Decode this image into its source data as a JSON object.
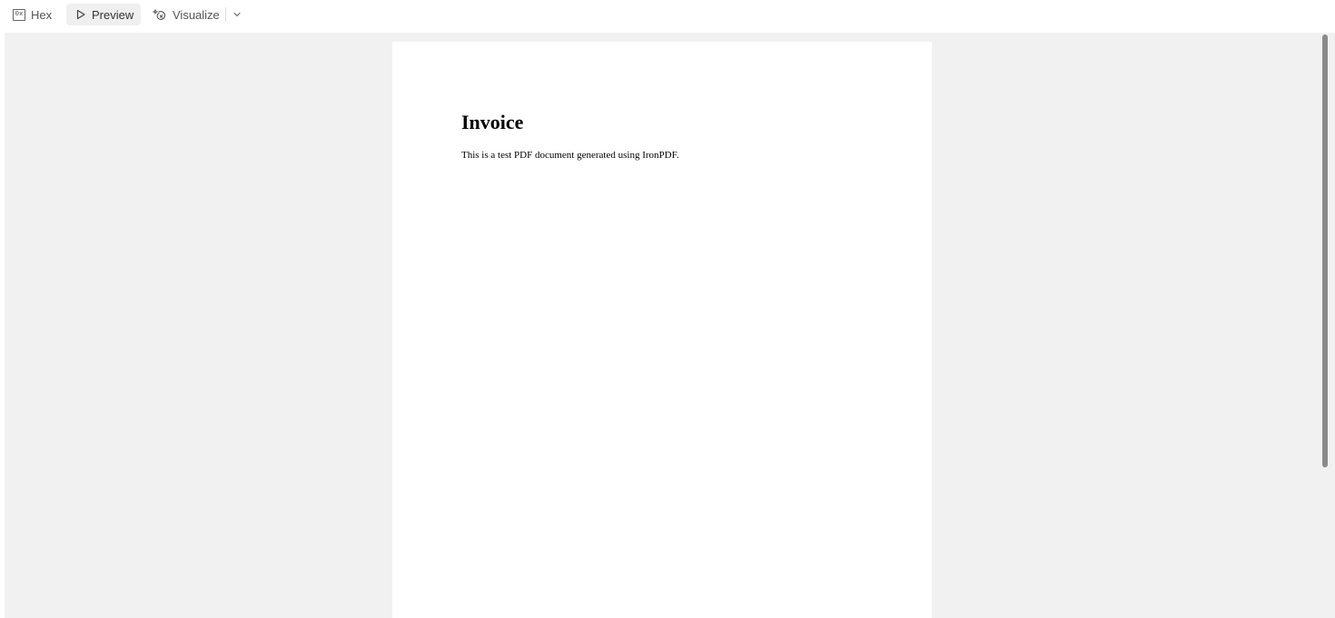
{
  "toolbar": {
    "hex_label": "Hex",
    "hex_badge": "0x",
    "preview_label": "Preview",
    "visualize_label": "Visualize",
    "active_tab": "Preview"
  },
  "document": {
    "title": "Invoice",
    "body": "This is a test PDF document generated using IronPDF."
  },
  "icons": {
    "hex": "hex-icon",
    "preview": "play-icon",
    "visualize": "sparkle-icon",
    "more": "chevron-down-icon"
  },
  "colors": {
    "viewer_background": "#f1f1f1",
    "page_background": "#ffffff",
    "active_tab_background": "#efefef"
  }
}
